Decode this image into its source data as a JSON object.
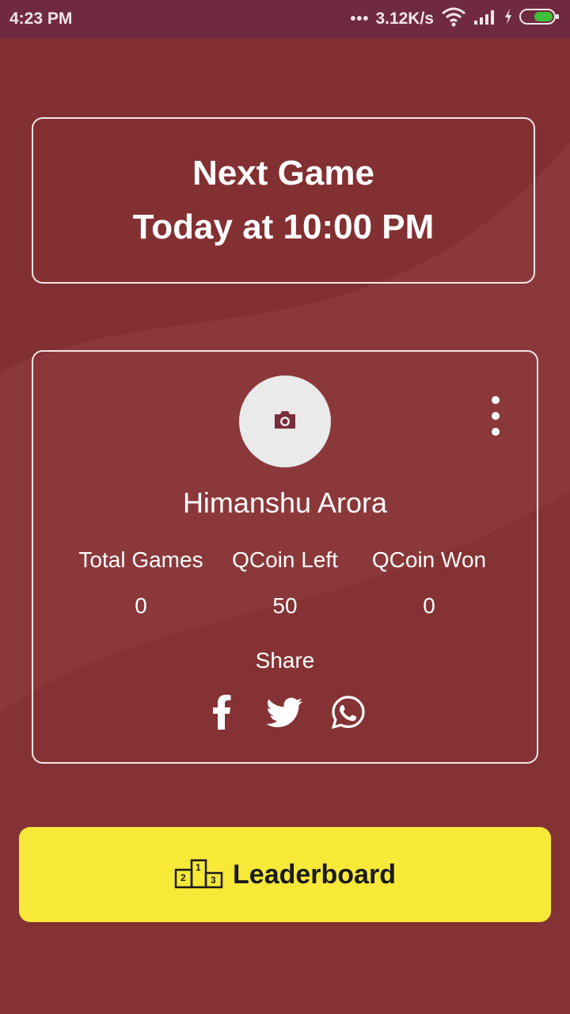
{
  "status_bar": {
    "time": "4:23 PM",
    "dots": "•••",
    "speed": "3.12K/s",
    "icons": [
      "wifi-icon",
      "signal-icon",
      "charging-icon",
      "battery-icon"
    ]
  },
  "next_game": {
    "title": "Next Game",
    "time": "Today at 10:00 PM"
  },
  "profile": {
    "name": "Himanshu Arora",
    "avatar_icon": "camera-icon",
    "stats": [
      {
        "label": "Total Games",
        "value": "0"
      },
      {
        "label": "QCoin Left",
        "value": "50"
      },
      {
        "label": "QCoin Won",
        "value": "0"
      }
    ],
    "share_label": "Share",
    "share_icons": [
      "facebook-icon",
      "twitter-icon",
      "whatsapp-icon"
    ]
  },
  "leaderboard": {
    "label": "Leaderboard",
    "icon": "podium-icon"
  },
  "colors": {
    "background": "#833033",
    "status_bar": "#702a3f",
    "button": "#f8e838"
  }
}
